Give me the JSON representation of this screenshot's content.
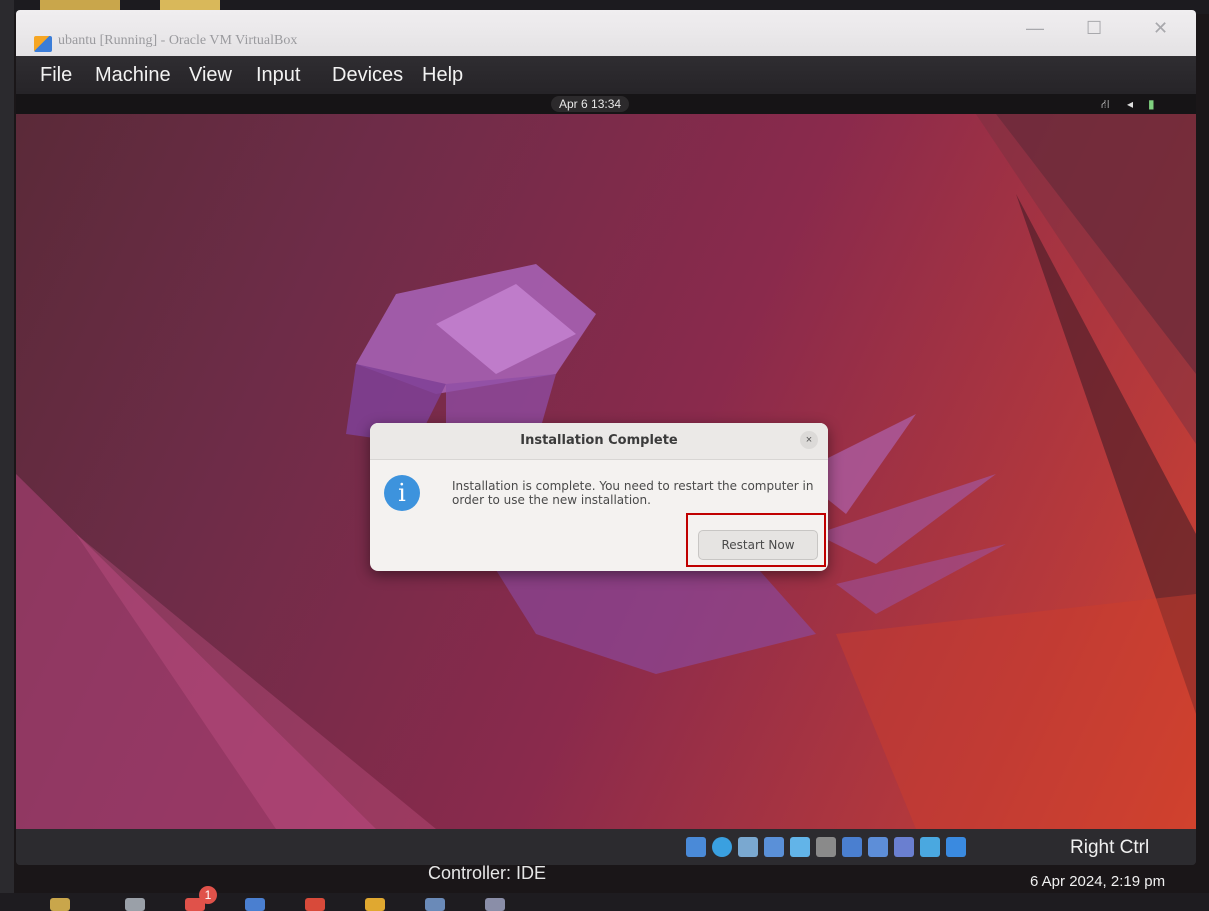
{
  "window": {
    "title": "ubantu [Running] - Oracle VM VirtualBox",
    "minimize": "—",
    "maximize": "☐",
    "close": "✕"
  },
  "menu": [
    "File",
    "Machine",
    "View",
    "Input",
    "Devices",
    "Help"
  ],
  "guest": {
    "clock": "Apr 6 13:34",
    "tray_icons": [
      "network-icon",
      "volume-icon",
      "battery-icon"
    ]
  },
  "dialog": {
    "title": "Installation Complete",
    "close_glyph": "×",
    "info_glyph": "i",
    "message": "Installation is complete. You need to restart the computer in order to use the new installation.",
    "button": "Restart Now"
  },
  "statusbar": {
    "host_key": "Right Ctrl",
    "icons": [
      "hard-disk-icon",
      "optical-drive-icon",
      "audio-icon",
      "network-icon",
      "usb-icon",
      "shared-folders-icon",
      "display-icon",
      "video-capture-icon",
      "cpu-icon",
      "mouse-integration-icon",
      "keyboard-icon"
    ]
  },
  "host": {
    "controller_text": "Controller: IDE",
    "datetime": "6 Apr 2024, 2:19 pm",
    "notification_count": "1"
  },
  "colors": {
    "highlight": "#c00000",
    "wallpaper_start": "#5a2a38",
    "wallpaper_end": "#d2452f",
    "info_blue": "#3d93dd"
  }
}
